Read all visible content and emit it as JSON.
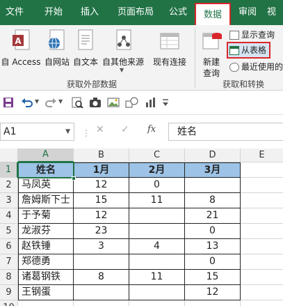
{
  "tabs": [
    {
      "label": "文件"
    },
    {
      "label": "开始"
    },
    {
      "label": "插入"
    },
    {
      "label": "页面布局"
    },
    {
      "label": "公式"
    },
    {
      "label": "数据"
    },
    {
      "label": "审阅"
    },
    {
      "label": "视"
    }
  ],
  "ribbon": {
    "external": {
      "access": "自 Access",
      "web": "自网站",
      "text": "自文本",
      "other": "自其他来源",
      "existing": "现有连接",
      "group_label": "获取外部数据"
    },
    "transform": {
      "new_query_line1": "新建",
      "new_query_line2": "查询",
      "show_queries": "显示查询",
      "from_table": "从表格",
      "recent_sources": "最近使用的",
      "group_label": "获取和转换"
    }
  },
  "formula_bar": {
    "name_box": "A1",
    "cancel": "✕",
    "enter": "✓",
    "fx": "fx",
    "value": "姓名"
  },
  "sheet": {
    "columns": [
      "A",
      "B",
      "C",
      "D",
      "E"
    ],
    "rows": [
      "1",
      "2",
      "3",
      "4",
      "5",
      "6",
      "7",
      "8",
      "9",
      "10"
    ],
    "header": [
      "姓名",
      "1月",
      "2月",
      "3月"
    ],
    "data": [
      [
        "马凤英",
        "12",
        "0",
        ""
      ],
      [
        "詹姆斯下士",
        "15",
        "11",
        "8"
      ],
      [
        "于予菊",
        "12",
        "",
        "21"
      ],
      [
        "龙淑芬",
        "23",
        "",
        "0"
      ],
      [
        "赵铁锤",
        "3",
        "4",
        "13"
      ],
      [
        "郑德勇",
        "",
        "",
        "0"
      ],
      [
        "诸葛钢铁",
        "8",
        "11",
        "15"
      ],
      [
        "王钢蛋",
        "",
        "",
        "12"
      ]
    ]
  },
  "colors": {
    "brand": "#217346",
    "highlight": "#d9262a",
    "header_fill": "#9dc3e6"
  }
}
